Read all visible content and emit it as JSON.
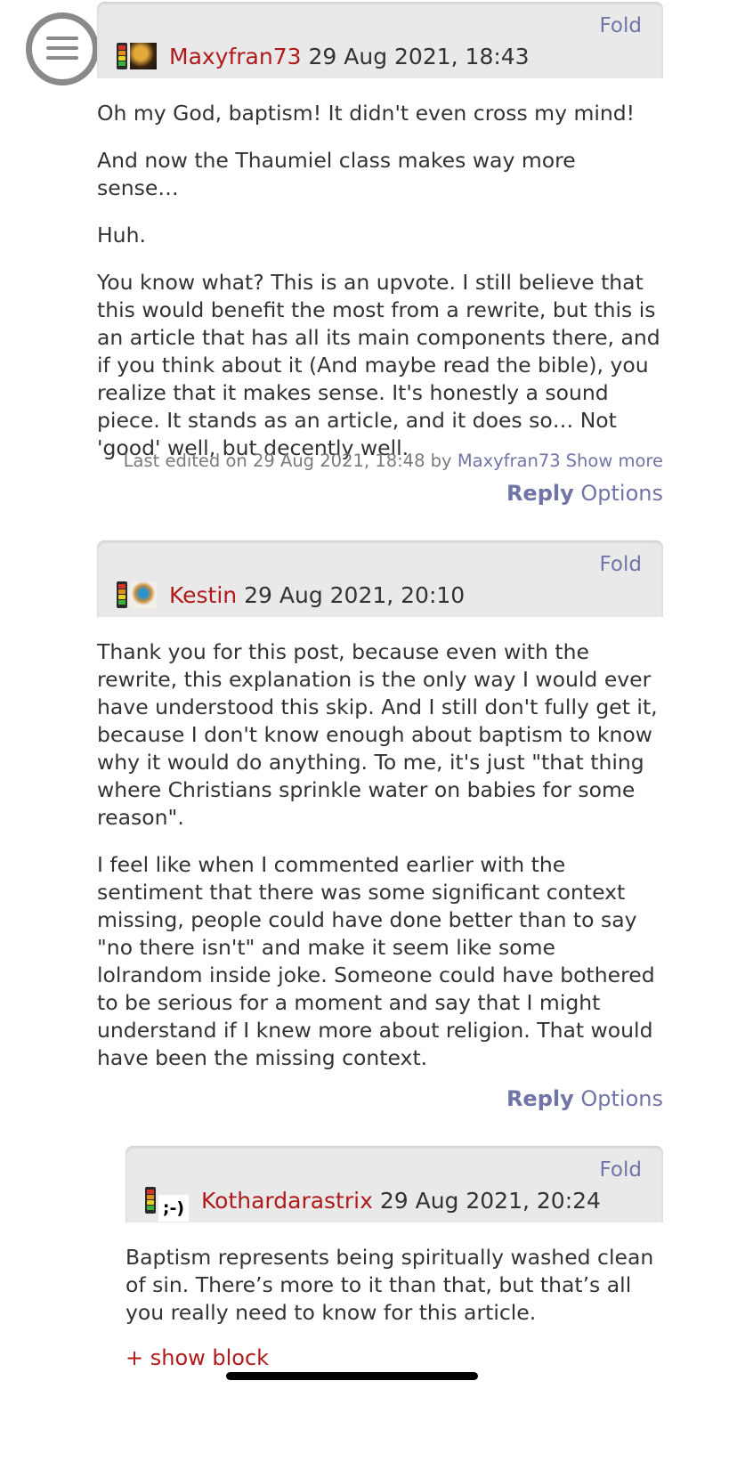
{
  "comments": [
    {
      "fold": "Fold",
      "user": "Maxyfran73",
      "date": "29 Aug 2021, 18:43",
      "paragraphs": [
        "Oh my God, baptism! It didn't even cross my mind!",
        "And now the Thaumiel class makes way more sense…",
        "Huh.",
        "You know what? This is an upvote. I still believe that this would benefit the most from a rewrite, but this is an article that has all its main components there, and if you think about it (And maybe read the bible), you realize that it makes sense. It's honestly a sound piece. It stands as an article, and it does so… Not 'good' well, but decently well."
      ],
      "edited_prefix": "Last edited on 29 Aug 2021, 18:48 by",
      "edited_user": "Maxyfran73",
      "show_more": "Show more",
      "reply": "Reply",
      "options": "Options"
    },
    {
      "fold": "Fold",
      "user": "Kestin",
      "date": "29 Aug 2021, 20:10",
      "paragraphs": [
        "Thank you for this post, because even with the rewrite, this explanation is the only way I would ever have understood this skip. And I still don't fully get it, because I don't know enough about baptism to know why it would do anything. To me, it's just \"that thing where Christians sprinkle water on babies for some reason\".",
        "I feel like when I commented earlier with the sentiment that there was some significant context missing, people could have done better than to say \"no there isn't\" and make it seem like some lolrandom inside joke. Someone could have bothered to be serious for a moment and say that I might understand if I knew more about religion. That would have been the missing context."
      ],
      "reply": "Reply",
      "options": "Options"
    },
    {
      "fold": "Fold",
      "user": "Kothardarastrix",
      "date": "29 Aug 2021, 20:24",
      "avatar_text": ";-)",
      "paragraphs": [
        "Baptism represents being spiritually washed clean of sin. There’s more to it than that, but that’s all you really need to know for this article."
      ],
      "show_block": "+ show block"
    }
  ]
}
